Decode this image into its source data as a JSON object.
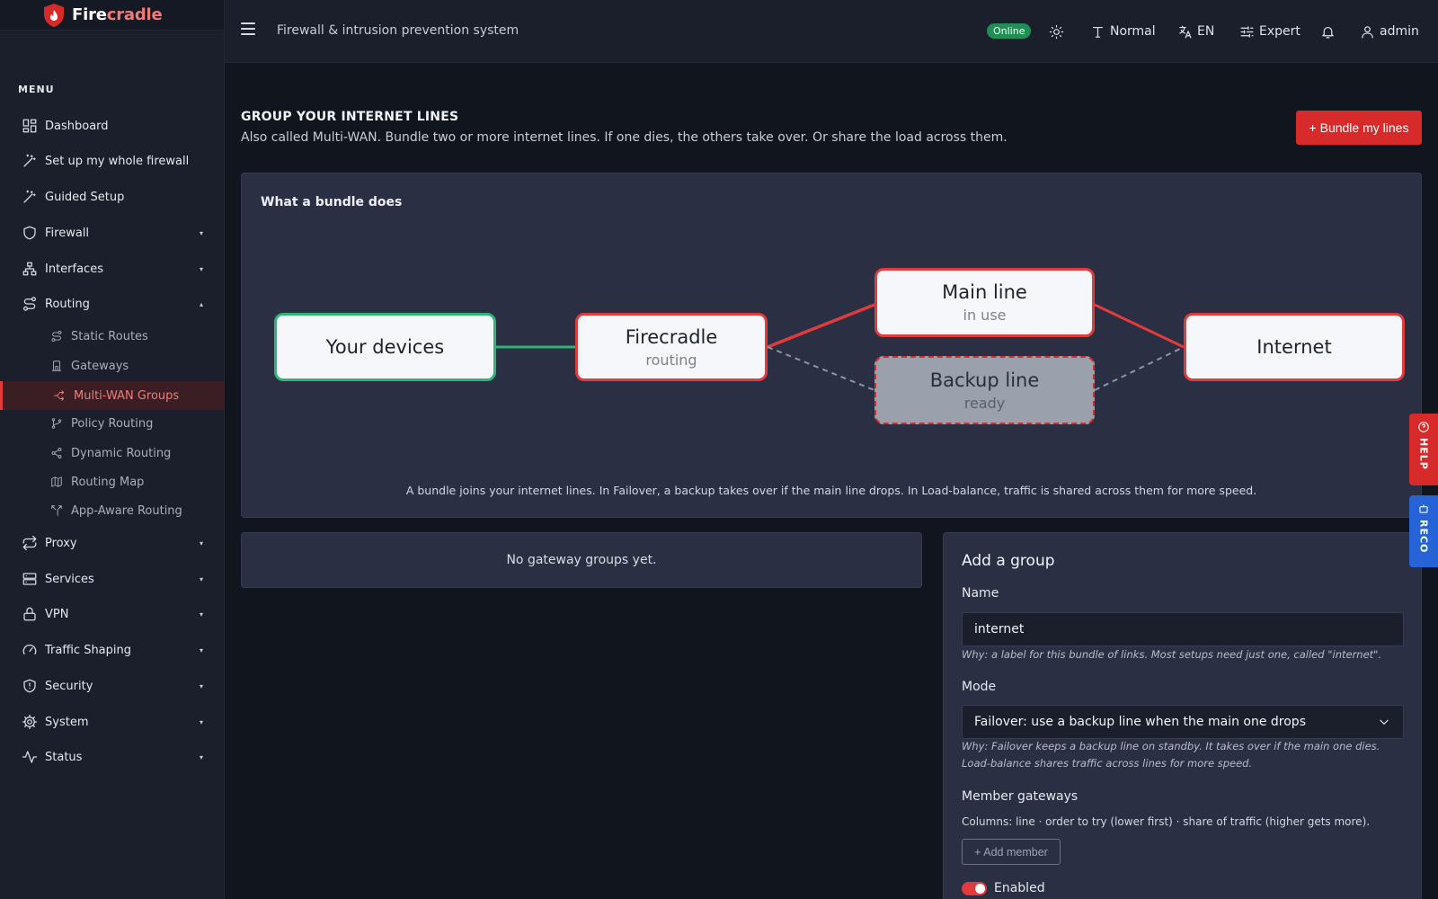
{
  "brand": {
    "part1": "Fire",
    "part2": "cradle"
  },
  "sidebar": {
    "menu_label": "MENU",
    "items": [
      {
        "label": "Dashboard",
        "icon": "dashboard-icon"
      },
      {
        "label": "Set up my whole firewall",
        "icon": "magic-wand-icon"
      },
      {
        "label": "Guided Setup",
        "icon": "magic-wand-icon"
      },
      {
        "label": "Firewall",
        "icon": "shield-icon",
        "caret": "▾"
      },
      {
        "label": "Interfaces",
        "icon": "network-icon",
        "caret": "▾"
      },
      {
        "label": "Routing",
        "icon": "route-icon",
        "caret": "▴"
      },
      {
        "label": "Proxy",
        "icon": "arrows-icon",
        "caret": "▾"
      },
      {
        "label": "Services",
        "icon": "server-icon",
        "caret": "▾"
      },
      {
        "label": "VPN",
        "icon": "lock-icon",
        "caret": "▾"
      },
      {
        "label": "Traffic Shaping",
        "icon": "gauge-icon",
        "caret": "▾"
      },
      {
        "label": "Security",
        "icon": "shield-alert-icon",
        "caret": "▾"
      },
      {
        "label": "System",
        "icon": "gear-icon",
        "caret": "▾"
      },
      {
        "label": "Status",
        "icon": "pulse-icon",
        "caret": "▾"
      }
    ],
    "routing_sub": [
      {
        "label": "Static Routes",
        "icon": "route-icon"
      },
      {
        "label": "Gateways",
        "icon": "gateway-icon"
      },
      {
        "label": "Multi-WAN Groups",
        "icon": "split-icon",
        "active": true
      },
      {
        "label": "Policy Routing",
        "icon": "branch-icon"
      },
      {
        "label": "Dynamic Routing",
        "icon": "share-icon"
      },
      {
        "label": "Routing Map",
        "icon": "map-icon"
      },
      {
        "label": "App-Aware Routing",
        "icon": "split-arrows-icon"
      }
    ]
  },
  "topbar": {
    "title": "Firewall & intrusion prevention system",
    "status": "Online",
    "text_size": "Normal",
    "language": "EN",
    "mode": "Expert",
    "user": "admin"
  },
  "page": {
    "title": "GROUP YOUR INTERNET LINES",
    "subtitle": "Also called Multi-WAN. Bundle two or more internet lines. If one dies, the others take over. Or share the load across them.",
    "primary_button": "+ Bundle my lines"
  },
  "diagram": {
    "label": "What a bundle does",
    "nodes": {
      "devices": {
        "title": "Your devices"
      },
      "firecradle": {
        "title": "Firecradle",
        "sub": "routing"
      },
      "main": {
        "title": "Main line",
        "sub": "in use"
      },
      "backup": {
        "title": "Backup line",
        "sub": "ready"
      },
      "internet": {
        "title": "Internet"
      }
    },
    "note": "A bundle joins your internet lines. In Failover, a backup takes over if the main line drops. In Load-balance, traffic is shared across them for more speed.",
    "colors": {
      "green": "#2bb673",
      "red": "#e23b3b",
      "dashed": "#8f94a6"
    }
  },
  "groups": {
    "empty_text": "No gateway groups yet."
  },
  "form": {
    "title": "Add a group",
    "name_label": "Name",
    "name_value": "internet",
    "name_help": "Why: a label for this bundle of links. Most setups need just one, called \"internet\".",
    "mode_label": "Mode",
    "mode_value": "Failover: use a backup line when the main one drops",
    "mode_help": "Why: Failover keeps a backup line on standby. It takes over if the main one dies. Load-balance shares traffic across lines for more speed.",
    "members_label": "Member gateways",
    "members_columns": "Columns: line · order to try (lower first) · share of traffic (higher gets more).",
    "add_member": "+ Add member",
    "enabled_label": "Enabled",
    "enabled": true
  },
  "side_tabs": {
    "help": "HELP",
    "reco": "RECO"
  }
}
